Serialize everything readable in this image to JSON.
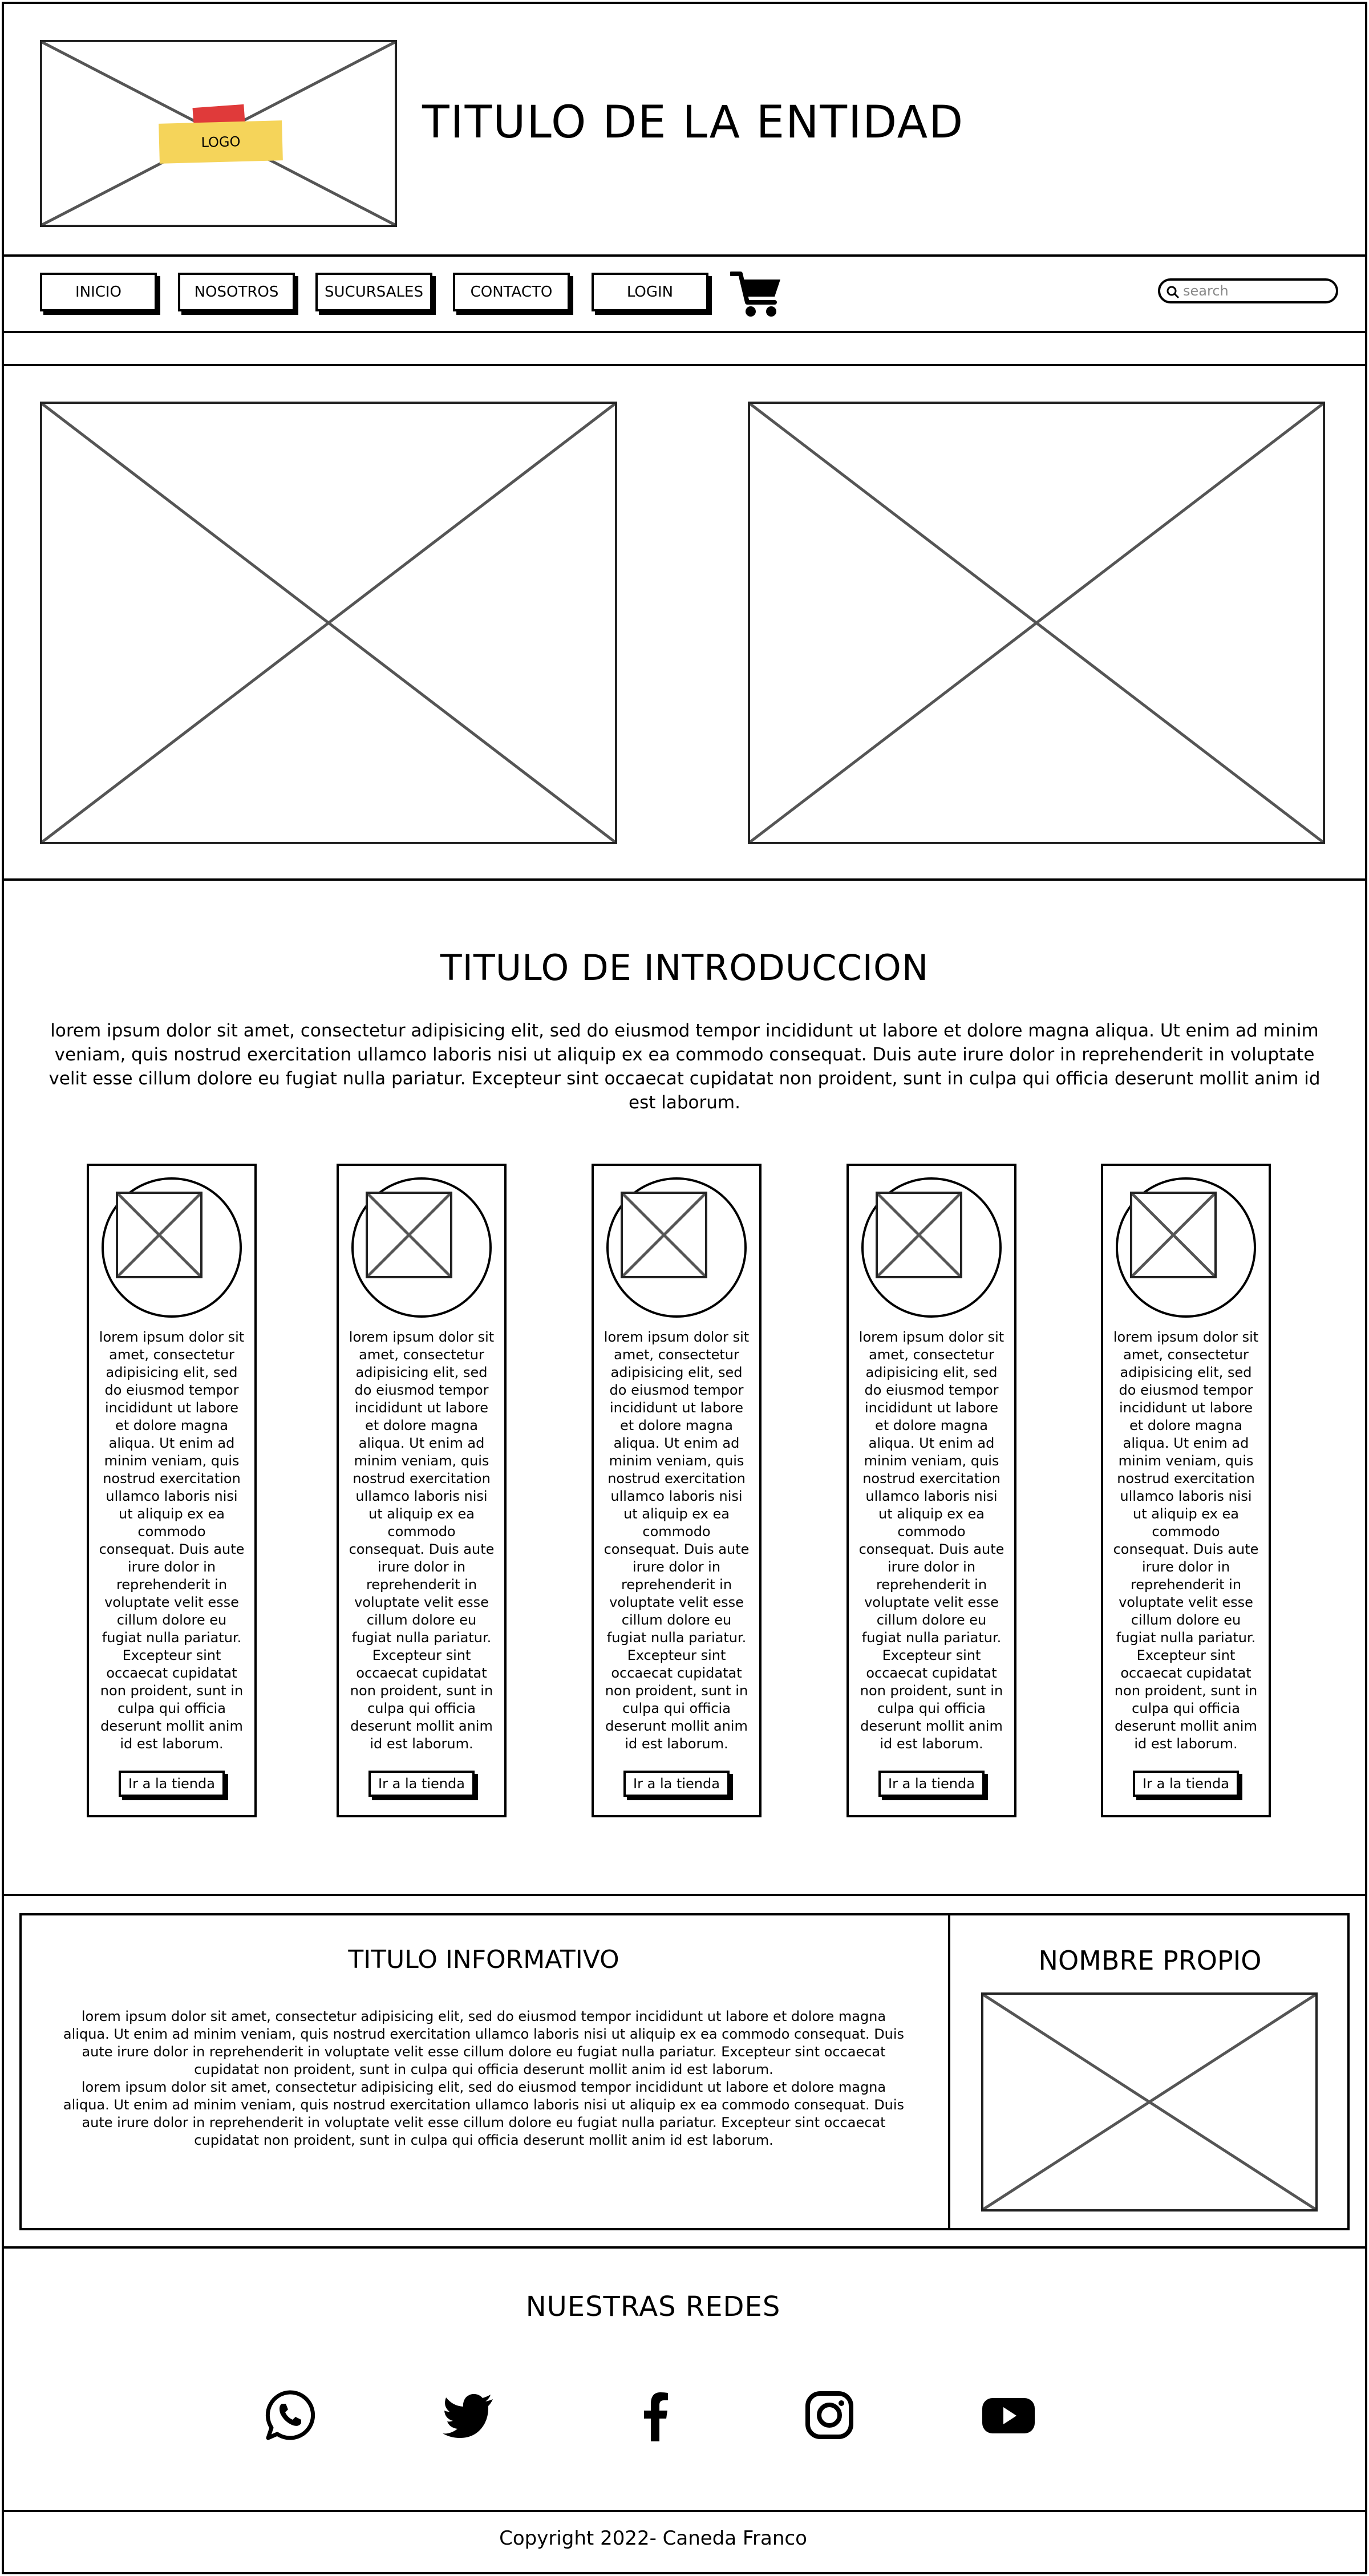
{
  "header": {
    "logo_label": "LOGO",
    "entity_title": "TITULO DE LA ENTIDAD"
  },
  "nav": {
    "items": [
      "INICIO",
      "NOSOTROS",
      "SUCURSALES",
      "CONTACTO",
      "LOGIN"
    ],
    "cart_icon": "shopping-cart-icon",
    "search_placeholder": "search"
  },
  "intro": {
    "title": "TITULO DE INTRODUCCION",
    "text": "lorem ipsum dolor sit amet, consectetur adipisicing elit, sed do eiusmod tempor incididunt ut labore et dolore magna aliqua. Ut enim ad minim veniam, quis nostrud exercitation ullamco laboris nisi ut aliquip ex ea commodo consequat. Duis aute irure dolor in reprehenderit in voluptate velit esse cillum dolore eu fugiat nulla pariatur. Excepteur sint occaecat cupidatat non proident, sunt in culpa qui officia deserunt mollit anim id est laborum."
  },
  "cards": [
    {
      "text": "lorem ipsum dolor sit amet, consectetur adipisicing elit, sed do eiusmod tempor incididunt ut labore et dolore magna aliqua. Ut enim ad minim veniam, quis nostrud exercitation ullamco laboris nisi ut aliquip ex ea commodo consequat. Duis aute irure dolor in reprehenderit in voluptate velit esse cillum dolore eu fugiat nulla pariatur. Excepteur sint occaecat cupidatat non proident, sunt in culpa qui officia deserunt mollit anim id est laborum.",
      "button": "Ir a la tienda"
    },
    {
      "text": "lorem ipsum dolor sit amet, consectetur adipisicing elit, sed do eiusmod tempor incididunt ut labore et dolore magna aliqua. Ut enim ad minim veniam, quis nostrud exercitation ullamco laboris nisi ut aliquip ex ea commodo consequat. Duis aute irure dolor in reprehenderit in voluptate velit esse cillum dolore eu fugiat nulla pariatur. Excepteur sint occaecat cupidatat non proident, sunt in culpa qui officia deserunt mollit anim id est laborum.",
      "button": "Ir a la tienda"
    },
    {
      "text": "lorem ipsum dolor sit amet, consectetur adipisicing elit, sed do eiusmod tempor incididunt ut labore et dolore magna aliqua. Ut enim ad minim veniam, quis nostrud exercitation ullamco laboris nisi ut aliquip ex ea commodo consequat. Duis aute irure dolor in reprehenderit in voluptate velit esse cillum dolore eu fugiat nulla pariatur. Excepteur sint occaecat cupidatat non proident, sunt in culpa qui officia deserunt mollit anim id est laborum.",
      "button": "Ir a la tienda"
    },
    {
      "text": "lorem ipsum dolor sit amet, consectetur adipisicing elit, sed do eiusmod tempor incididunt ut labore et dolore magna aliqua. Ut enim ad minim veniam, quis nostrud exercitation ullamco laboris nisi ut aliquip ex ea commodo consequat. Duis aute irure dolor in reprehenderit in voluptate velit esse cillum dolore eu fugiat nulla pariatur. Excepteur sint occaecat cupidatat non proident, sunt in culpa qui officia deserunt mollit anim id est laborum.",
      "button": "Ir a la tienda"
    },
    {
      "text": "lorem ipsum dolor sit amet, consectetur adipisicing elit, sed do eiusmod tempor incididunt ut labore et dolore magna aliqua. Ut enim ad minim veniam, quis nostrud exercitation ullamco laboris nisi ut aliquip ex ea commodo consequat. Duis aute irure dolor in reprehenderit in voluptate velit esse cillum dolore eu fugiat nulla pariatur. Excepteur sint occaecat cupidatat non proident, sunt in culpa qui officia deserunt mollit anim id est laborum.",
      "button": "Ir a la tienda"
    }
  ],
  "info": {
    "title": "TITULO INFORMATIVO",
    "paragraphs": [
      "lorem ipsum dolor sit amet, consectetur adipisicing elit, sed do eiusmod tempor incididunt ut labore et dolore magna aliqua. Ut enim ad minim veniam, quis nostrud exercitation ullamco laboris nisi ut aliquip ex ea commodo consequat. Duis aute irure dolor in reprehenderit in voluptate velit esse cillum dolore eu fugiat nulla pariatur. Excepteur sint occaecat cupidatat non proident, sunt in culpa qui officia deserunt mollit anim id est laborum.",
      "lorem ipsum dolor sit amet, consectetur adipisicing elit, sed do eiusmod tempor incididunt ut labore et dolore magna aliqua. Ut enim ad minim veniam, quis nostrud exercitation ullamco laboris nisi ut aliquip ex ea commodo consequat. Duis aute irure dolor in reprehenderit in voluptate velit esse cillum dolore eu fugiat nulla pariatur. Excepteur sint occaecat cupidatat non proident, sunt in culpa qui officia deserunt mollit anim id est laborum."
    ],
    "proper_name": "NOMBRE PROPIO"
  },
  "social": {
    "title": "NUESTRAS REDES",
    "icons": [
      "whatsapp-icon",
      "twitter-icon",
      "facebook-icon",
      "instagram-icon",
      "youtube-icon"
    ]
  },
  "footer": {
    "copyright": "Copyright 2022- Caneda Franco"
  }
}
